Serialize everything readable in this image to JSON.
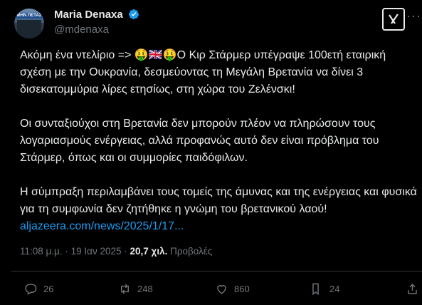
{
  "author": {
    "name": "Maria Denaxa",
    "handle": "@mdenaxa",
    "avatar_text": "ΜΗΝ ΠΕΤΑΣ"
  },
  "tweet": {
    "p1": "Ακόμη ένα ντελίριο => 🤑🇬🇧🤑Ο Κιρ Στάρμερ υπέγραψε 100ετή εταιρική σχέση με την Ουκρανία, δεσμεύοντας τη Μεγάλη Βρετανία να δίνει 3 δισεκατομμύρια λίρες ετησίως, στη χώρα του Ζελένσκι!",
    "p2": "Οι συνταξιούχοι στη Βρετανία δεν μπορούν πλέον να πληρώσουν τους λογαριασμούς ενέργειας, αλλά προφανώς αυτό δεν είναι  πρόβλημα του Στάρμερ, όπως και οι συμμορίες παιδόφιλων.",
    "p3": "Η σύμπραξη περιλαμβάνει τους τομείς της άμυνας και της ενέργειας και φυσικά για τη συμφωνία δεν ζητήθηκε η γνώμη του βρετανικού λαού!",
    "link": "aljazeera.com/news/2025/1/17..."
  },
  "meta": {
    "time": "11:08 μ.μ.",
    "sep": "·",
    "date": "19 Ιαν 2025",
    "views": "20,7 χιλ.",
    "views_label": "Προβολές"
  },
  "actions": {
    "replies": "26",
    "reposts": "248",
    "likes": "860",
    "bookmarks": "24"
  },
  "colors": {
    "link": "#1d9bf0",
    "verified": "#1d9bf0",
    "muted": "#71767b"
  },
  "icons": [
    "verified-badge-icon",
    "grok-icon",
    "more-icon",
    "reply-icon",
    "repost-icon",
    "like-icon",
    "bookmark-icon",
    "share-icon"
  ]
}
